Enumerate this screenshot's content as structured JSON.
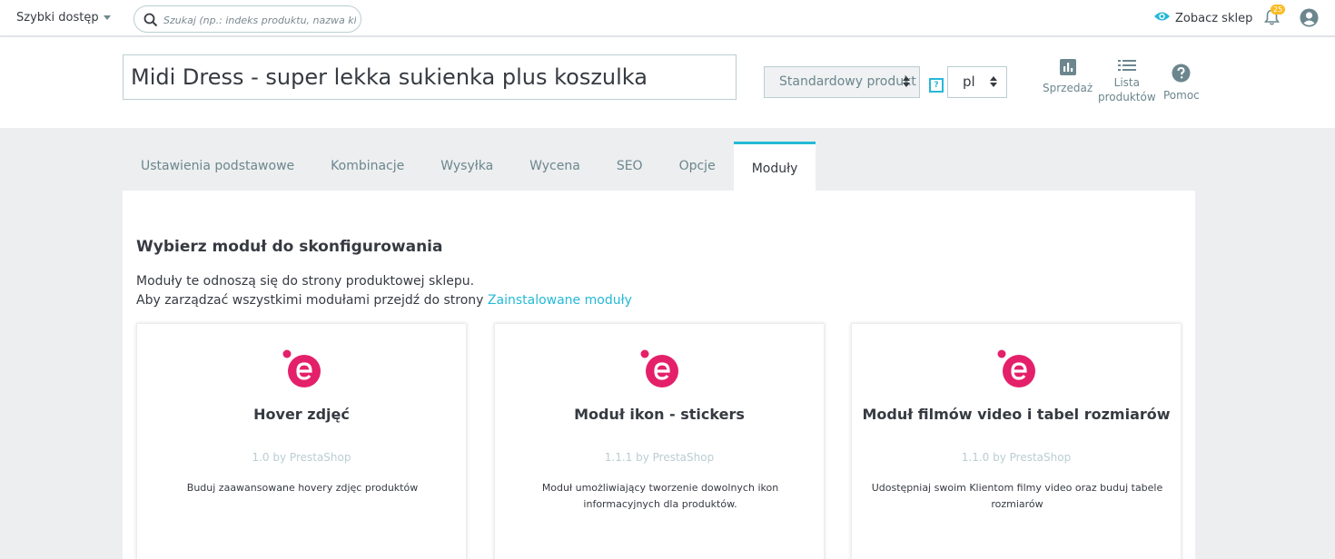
{
  "topbar": {
    "quick_access": "Szybki dostęp",
    "search_placeholder": "Szukaj (np.: indeks produktu, nazwa klienta…)",
    "view_shop": "Zobacz sklep",
    "notifications_count": "25",
    "icons": [
      "search-icon",
      "eye-icon",
      "bell-icon",
      "user-icon",
      "chevron-down-icon"
    ]
  },
  "header": {
    "product_name": "Midi Dress - super lekka sukienka plus koszulka",
    "product_type": "Standardowy produkt",
    "help_badge": "?",
    "language": "pl",
    "buttons": {
      "sales": "Sprzedaż",
      "product_list_1": "Lista",
      "product_list_2": "produktów",
      "help": "Pomoc"
    }
  },
  "tabs": [
    {
      "label": "Ustawienia podstawowe",
      "active": false
    },
    {
      "label": "Kombinacje",
      "active": false
    },
    {
      "label": "Wysyłka",
      "active": false
    },
    {
      "label": "Wycena",
      "active": false
    },
    {
      "label": "SEO",
      "active": false
    },
    {
      "label": "Opcje",
      "active": false
    },
    {
      "label": "Moduły",
      "active": true
    }
  ],
  "content": {
    "title": "Wybierz moduł do skonfigurowania",
    "line1": "Moduły te odnoszą się do strony produktowej sklepu.",
    "line2": "Aby zarządzać wszystkimi modułami przejdź do strony",
    "link": "Zainstalowane moduły",
    "modules": [
      {
        "name": "Hover zdjęć",
        "version": "1.0 by PrestaShop",
        "description": "Buduj zaawansowane hovery zdjęc produktów"
      },
      {
        "name": "Moduł ikon - stickers",
        "version": "1.1.1 by PrestaShop",
        "description": "Moduł umożliwiający tworzenie dowolnych ikon informacyjnych dla produktów."
      },
      {
        "name": "Moduł filmów video i tabel rozmiarów",
        "version": "1.1.0 by PrestaShop",
        "description": "Udostępniaj swoim Klientom filmy video oraz buduj tabele rozmiarów"
      }
    ]
  },
  "colors": {
    "accent": "#25b9d7",
    "logo": "#e4206a",
    "badge": "#fbbb22",
    "background": "#eceeef"
  }
}
